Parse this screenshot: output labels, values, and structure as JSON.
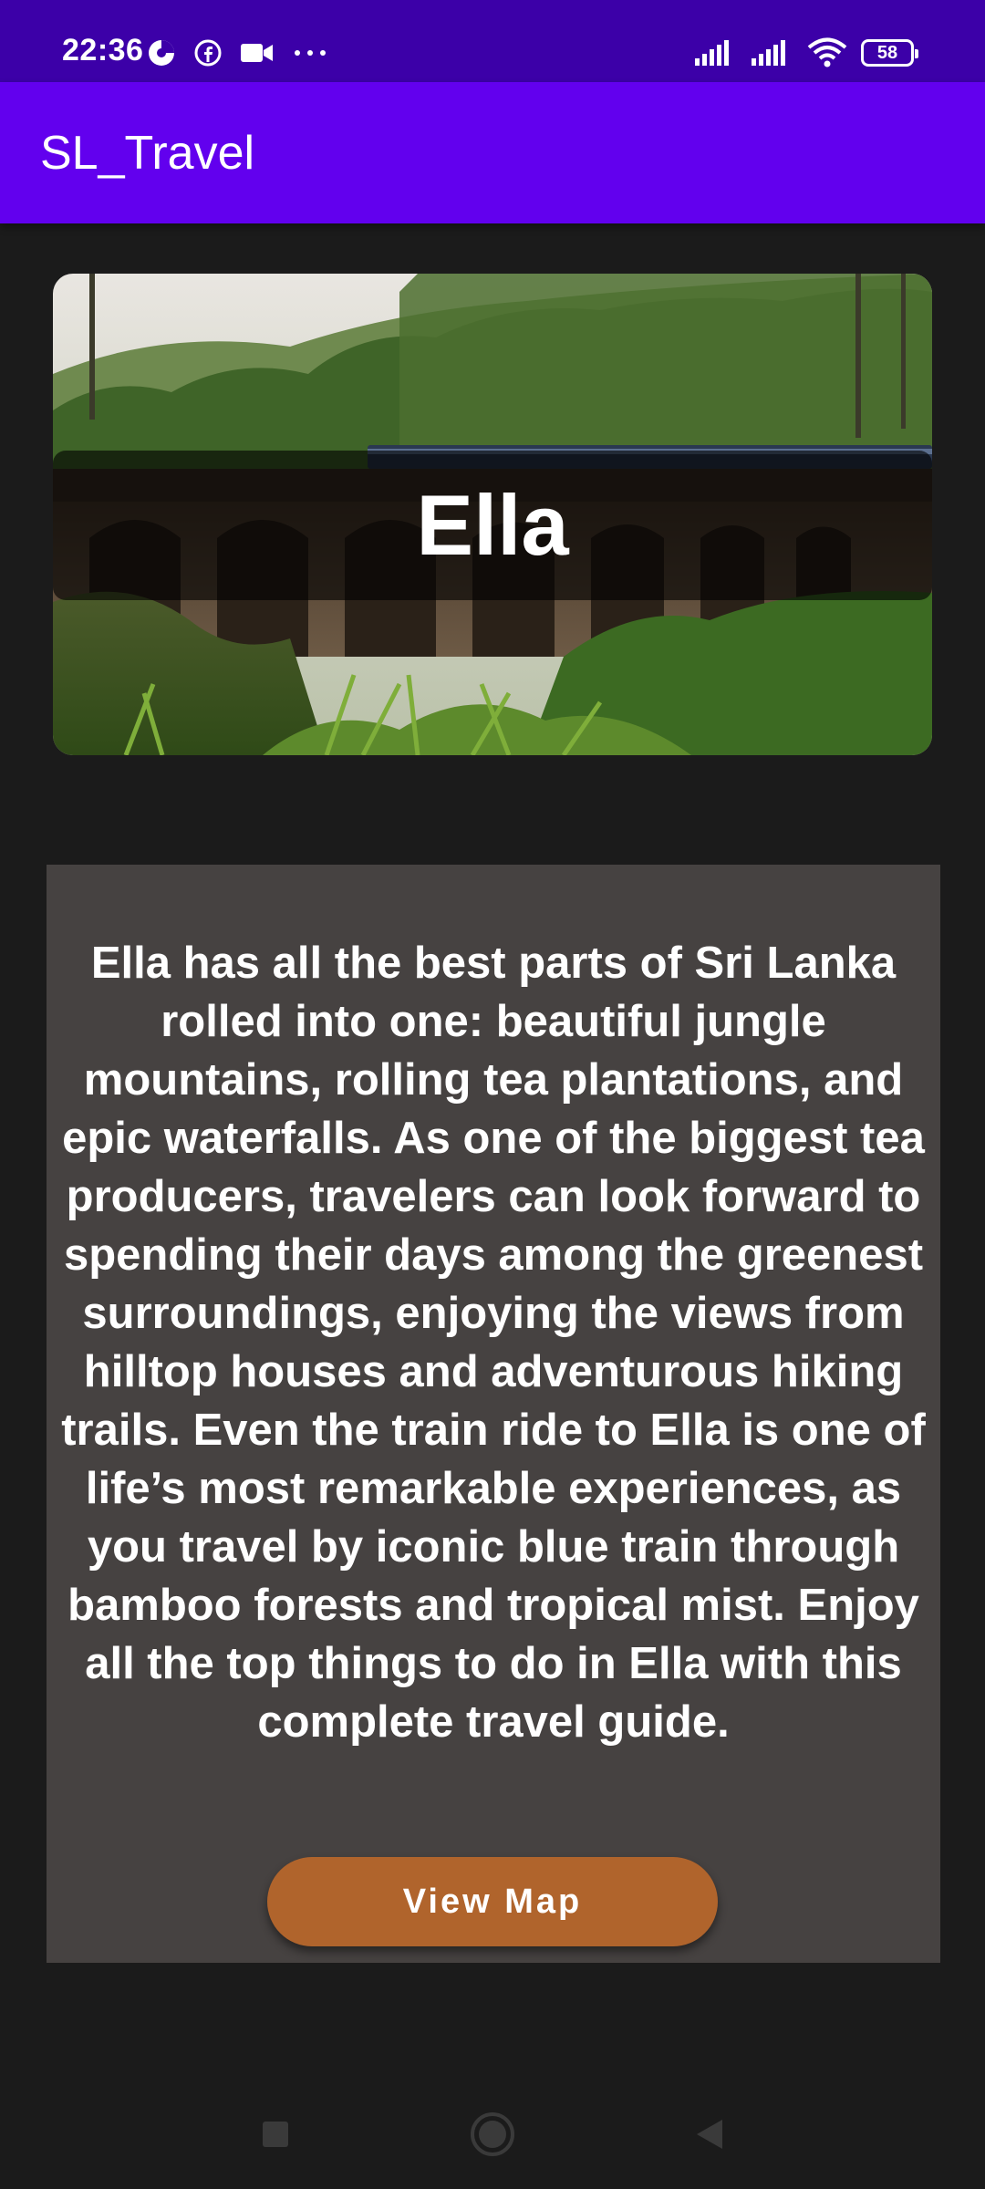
{
  "status_bar": {
    "time": "22:36",
    "battery_level": "58",
    "left_icons": [
      "data-saver-icon",
      "facebook-icon",
      "video-camera-icon",
      "more-dots-icon"
    ],
    "right_icons": [
      "signal-icon",
      "signal-icon",
      "wifi-icon",
      "battery-icon"
    ]
  },
  "app_bar": {
    "title": "SL_Travel",
    "color": "#6200ee"
  },
  "hero": {
    "title": "Ella",
    "image": "ella-nine-arch-bridge-photo"
  },
  "description": {
    "text": "Ella has all the best parts of Sri Lanka rolled into one: beautiful jungle mountains, rolling tea plantations, and epic waterfalls. As one of the biggest tea producers, travelers can look forward to spending their days among the greenest surroundings, enjoying the views from hilltop houses and adventurous hiking trails. Even the train ride to Ella is one of life’s most remarkable experiences, as you travel by iconic blue train through bamboo forests and tropical mist. Enjoy all the top things to do in Ella with this complete travel guide."
  },
  "actions": {
    "view_map_label": "View Map",
    "button_color": "#b0642c"
  },
  "nav": {
    "buttons": [
      "recents-square-icon",
      "home-circle-icon",
      "back-triangle-icon"
    ]
  }
}
